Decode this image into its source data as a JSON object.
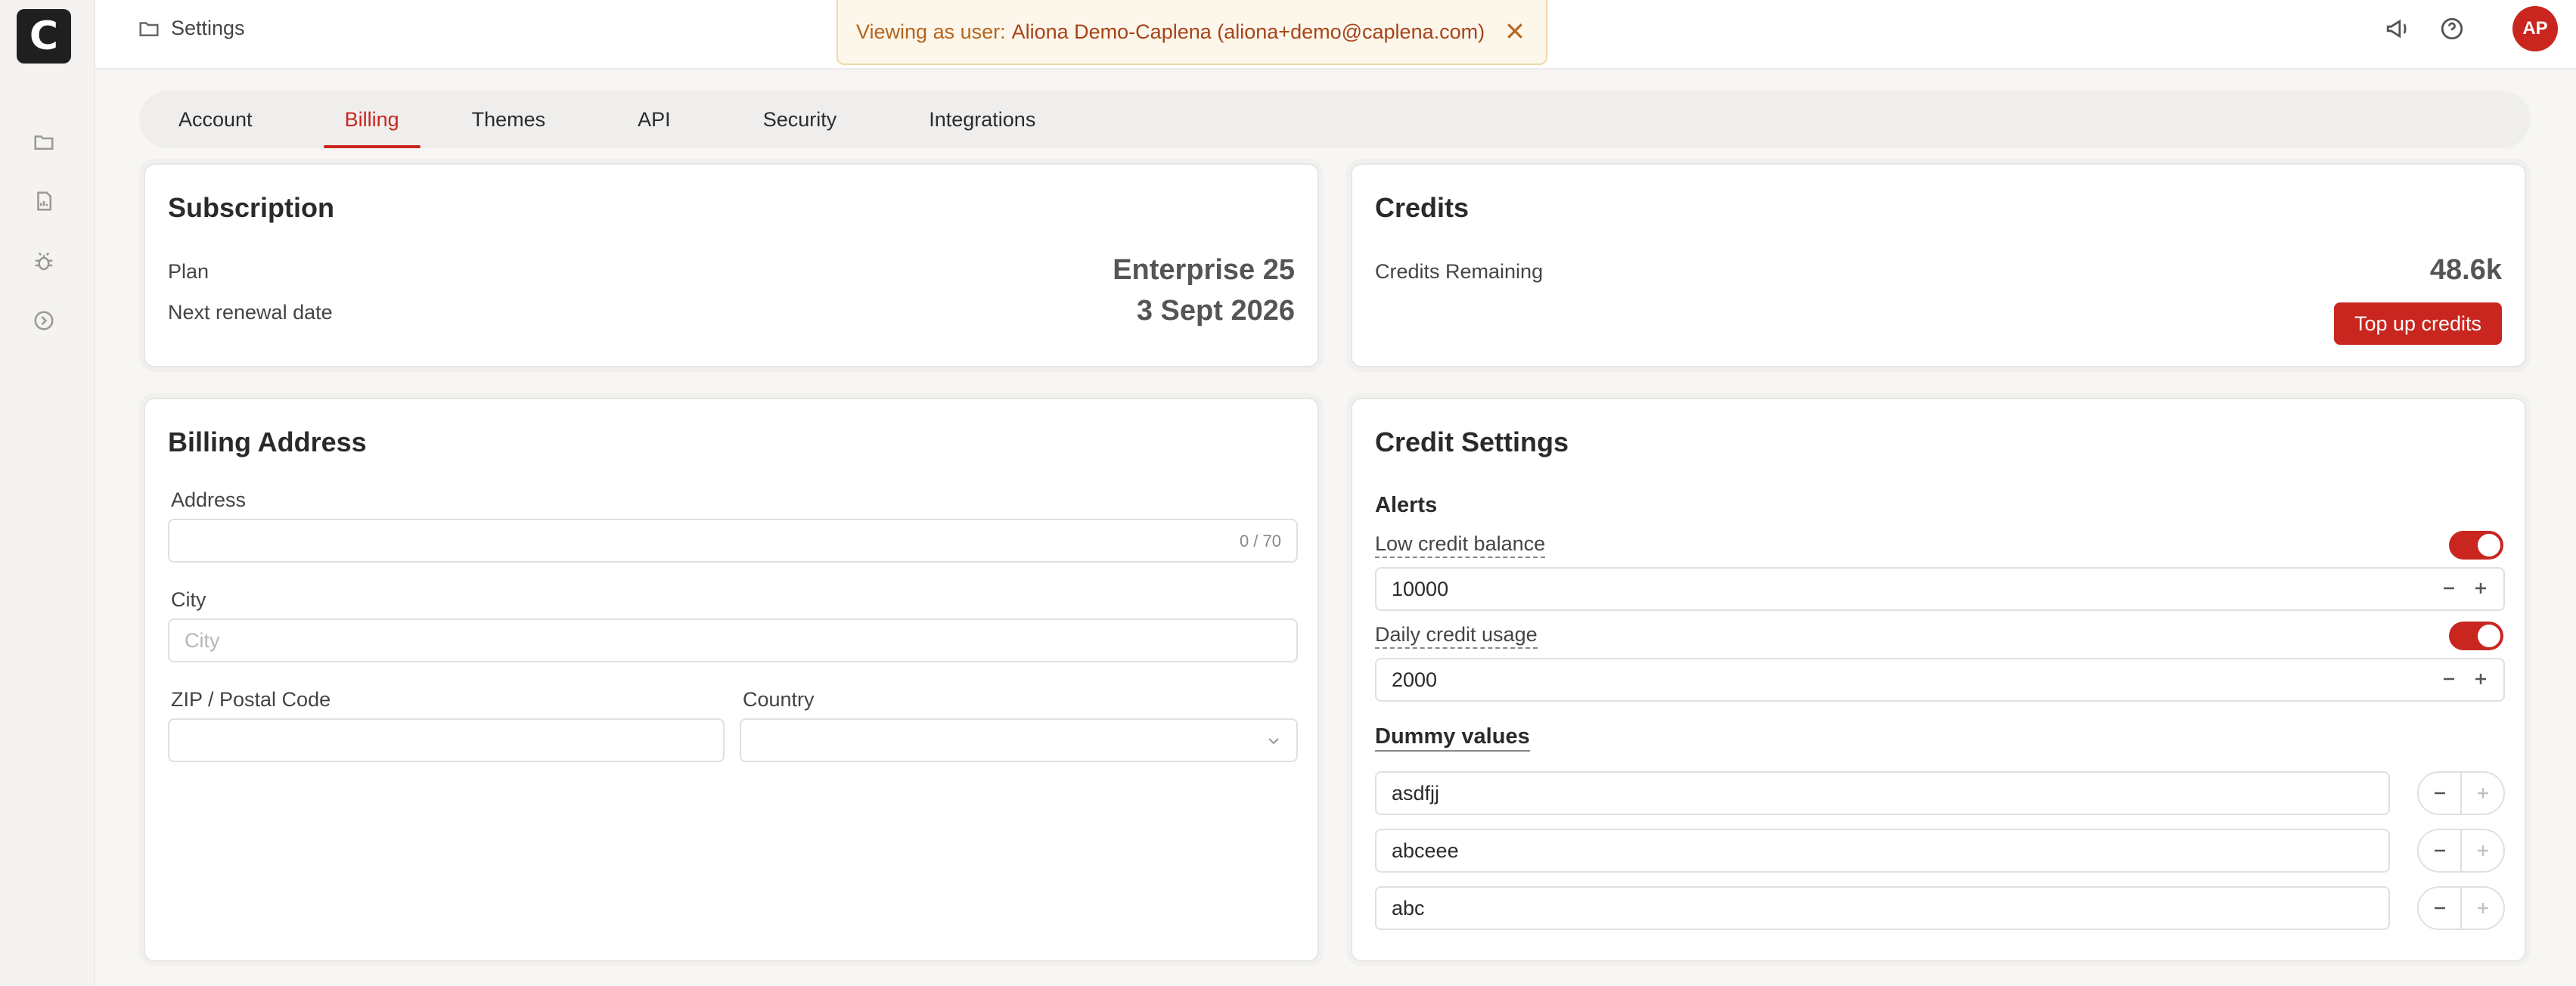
{
  "header": {
    "breadcrumb": "Settings",
    "banner_prefix": "Viewing as user:",
    "banner_user": "Aliona Demo-Caplena (aliona+demo@caplena.com)",
    "avatar_initials": "AP"
  },
  "logo": "C",
  "tabs": [
    {
      "label": "Account"
    },
    {
      "label": "Billing"
    },
    {
      "label": "Themes"
    },
    {
      "label": "API"
    },
    {
      "label": "Security"
    },
    {
      "label": "Integrations"
    }
  ],
  "subscription": {
    "title": "Subscription",
    "plan_label": "Plan",
    "plan_value": "Enterprise 25",
    "renewal_label": "Next renewal date",
    "renewal_value": "3 Sept 2026"
  },
  "credits": {
    "title": "Credits",
    "remaining_label": "Credits Remaining",
    "remaining_value": "48.6k",
    "topup_label": "Top up credits"
  },
  "billing_address": {
    "title": "Billing Address",
    "address_label": "Address",
    "address_value": "",
    "address_counter": "0 / 70",
    "city_label": "City",
    "city_placeholder": "City",
    "zip_label": "ZIP / Postal Code",
    "country_label": "Country"
  },
  "credit_settings": {
    "title": "Credit Settings",
    "alerts_heading": "Alerts",
    "low_balance_label": "Low credit balance",
    "low_balance_value": "10000",
    "daily_usage_label": "Daily credit usage",
    "daily_usage_value": "2000",
    "dummy_heading": "Dummy values",
    "dummy_values": [
      "asdfjj",
      "abceee",
      "abc"
    ]
  },
  "colors": {
    "accent": "#c8261f",
    "banner_bg": "#fdf6ea",
    "banner_text": "#b5651d"
  }
}
